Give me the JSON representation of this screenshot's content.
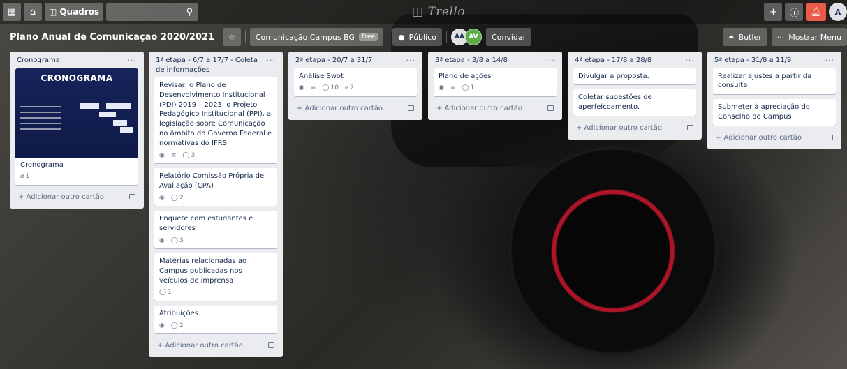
{
  "header": {
    "boards_label": "Quadros",
    "logo_text": "Trello",
    "avatar_initial": "A"
  },
  "board": {
    "title": "Plano Anual de Comunicação 2020/2021",
    "team_label": "Comunicação Campus BG",
    "team_badge": "Free",
    "visibility_label": "Público",
    "members": [
      "AA",
      "AV"
    ],
    "invite_label": "Convidar",
    "butler_label": "Butler",
    "menu_label": "Mostrar Menu"
  },
  "add_card_label": "+ Adicionar outro cartão",
  "lists": [
    {
      "title": "Cronograma",
      "cover_title": "CRONOGRAMA",
      "cards": [
        {
          "text": "Cronograma",
          "attachments": "1"
        }
      ]
    },
    {
      "title": "1ª etapa - 6/7 a 17/7 - Coleta de informações",
      "cards": [
        {
          "text": "Revisar: o Plano de Desenvolvimento Institucional (PDI) 2019 – 2023, o Projeto Pedagógico Institucional (PPI), a legislação sobre Comunicação no âmbito do Governo Federal e normativas do IFRS",
          "comments": "3"
        },
        {
          "text": "Relatório Comissão Própria de Avaliação (CPA)",
          "comments": "2"
        },
        {
          "text": "Enquete com estudantes e servidores",
          "comments": "3"
        },
        {
          "text": "Matérias relacionadas ao Campus publicadas nos veículos de imprensa",
          "comments": "1"
        },
        {
          "text": "Atribuições",
          "comments": "2"
        }
      ]
    },
    {
      "title": "2ª etapa - 20/7 a 31/7",
      "cards": [
        {
          "text": "Análise Swot",
          "comments": "10",
          "attachments": "2"
        }
      ]
    },
    {
      "title": "3ª etapa - 3/8 a 14/8",
      "cards": [
        {
          "text": "Plano de ações",
          "comments": "1"
        }
      ]
    },
    {
      "title": "4ª etapa - 17/8 a 28/8",
      "cards": [
        {
          "text": "Divulgar a proposta."
        },
        {
          "text": "Coletar sugestões de aperfeiçoamento."
        }
      ]
    },
    {
      "title": "5ª etapa - 31/8 a 11/9",
      "cards": [
        {
          "text": "Realizar ajustes a partir da consulta"
        },
        {
          "text": "Submeter à apreciação do Conselho de Campus"
        }
      ]
    }
  ]
}
